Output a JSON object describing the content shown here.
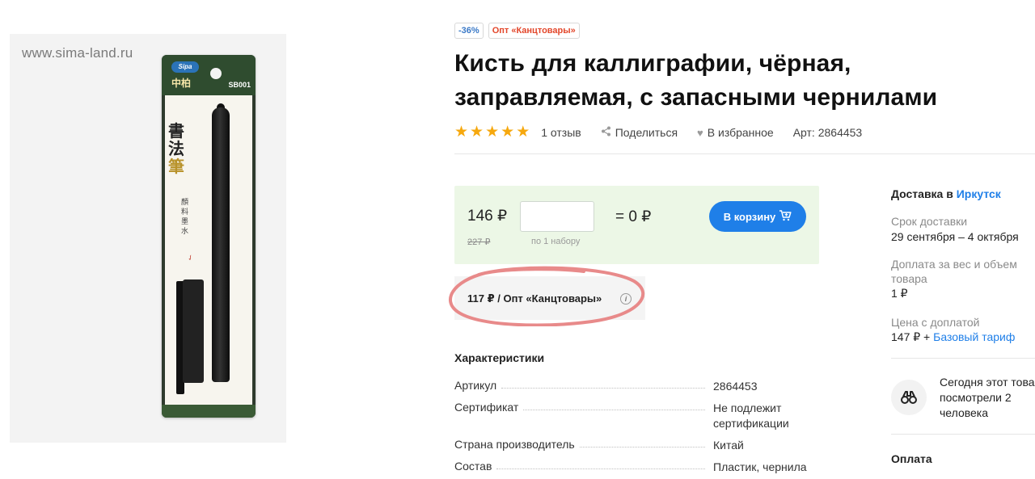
{
  "product_image": {
    "watermark": "www.sima-land.ru",
    "package_brand": "Sipa",
    "package_brand_cn": "中柏",
    "package_code": "SB001",
    "package_cn_big": [
      "書",
      "法",
      "筆"
    ],
    "package_cn_small": "顏料墨水"
  },
  "tags": {
    "discount": "-36%",
    "wholesale": "Опт «Канцтовары»"
  },
  "title": "Кисть для каллиграфии, чёрная, заправляемая, с запасными чернилами",
  "rating": {
    "stars": 5,
    "reviews": "1 отзыв"
  },
  "actions": {
    "share": "Поделиться",
    "favorite": "В избранное",
    "article": "Арт: 2864453"
  },
  "price": {
    "current": "146 ₽",
    "old": "227 ₽",
    "quantity_value": "",
    "quantity_note": "по 1 набору",
    "total": "= 0 ₽",
    "cart_button": "В корзину"
  },
  "wholesale_price": "117 ₽ / Опт «Канцтовары»",
  "characteristics": {
    "title": "Характеристики",
    "rows": [
      {
        "key": "Артикул",
        "value": "2864453"
      },
      {
        "key": "Сертификат",
        "value": "Не подлежит сертификации"
      },
      {
        "key": "Страна производитель",
        "value": "Китай"
      },
      {
        "key": "Состав",
        "value": "Пластик, чернила"
      }
    ]
  },
  "delivery": {
    "title_prefix": "Доставка в ",
    "city": "Иркутск",
    "term_label": "Срок доставки",
    "term_value": "29 сентября – 4 октября",
    "surcharge_label": "Доплата за вес и объем товара",
    "surcharge_value": "1 ₽",
    "price_with_surcharge_label": "Цена с доплатой",
    "price_with_surcharge_value": "147 ₽ + ",
    "tariff_link": "Базовый тариф",
    "viewed_line1": "Сегодня этот това",
    "viewed_line2": "посмотрели 2",
    "viewed_line3": "человека",
    "payment_title": "Оплата"
  },
  "colors": {
    "accent_blue": "#1f7fe8",
    "star_color": "#f6a80e",
    "price_block_bg": "#ecf7e6",
    "opt_tag": "#e3462a",
    "annotation_scribble": "#e88a8a"
  }
}
